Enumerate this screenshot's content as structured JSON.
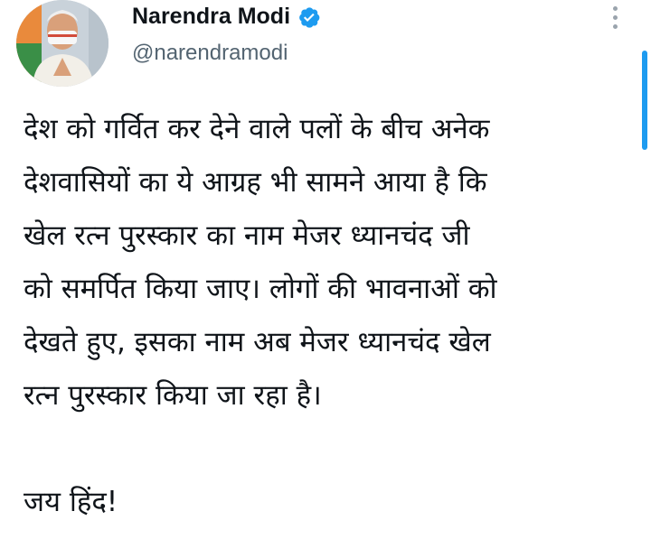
{
  "author": {
    "name": "Narendra Modi",
    "handle": "@narendramodi",
    "avatar_icon": "profile-photo",
    "verified_icon": "verified-badge-icon",
    "verified_color": "#1d9bf0"
  },
  "menu": {
    "icon": "more-options-icon"
  },
  "tweet": {
    "lines": [
      "देश को गर्वित कर देने वाले पलों के बीच अनेक",
      "देशवासियों का ये आग्रह भी सामने आया है कि",
      "खेल रत्न पुरस्कार का नाम मेजर ध्यानचंद जी",
      "को समर्पित किया जाए। लोगों की भावनाओं को",
      "देखते हुए, इसका नाम अब मेजर ध्यानचंद खेल",
      "रत्न पुरस्कार किया जा रहा है।"
    ],
    "closing": "जय हिंद!"
  },
  "colors": {
    "text": "#0f1419",
    "secondary": "#536471",
    "accent": "#1d9bf0"
  }
}
